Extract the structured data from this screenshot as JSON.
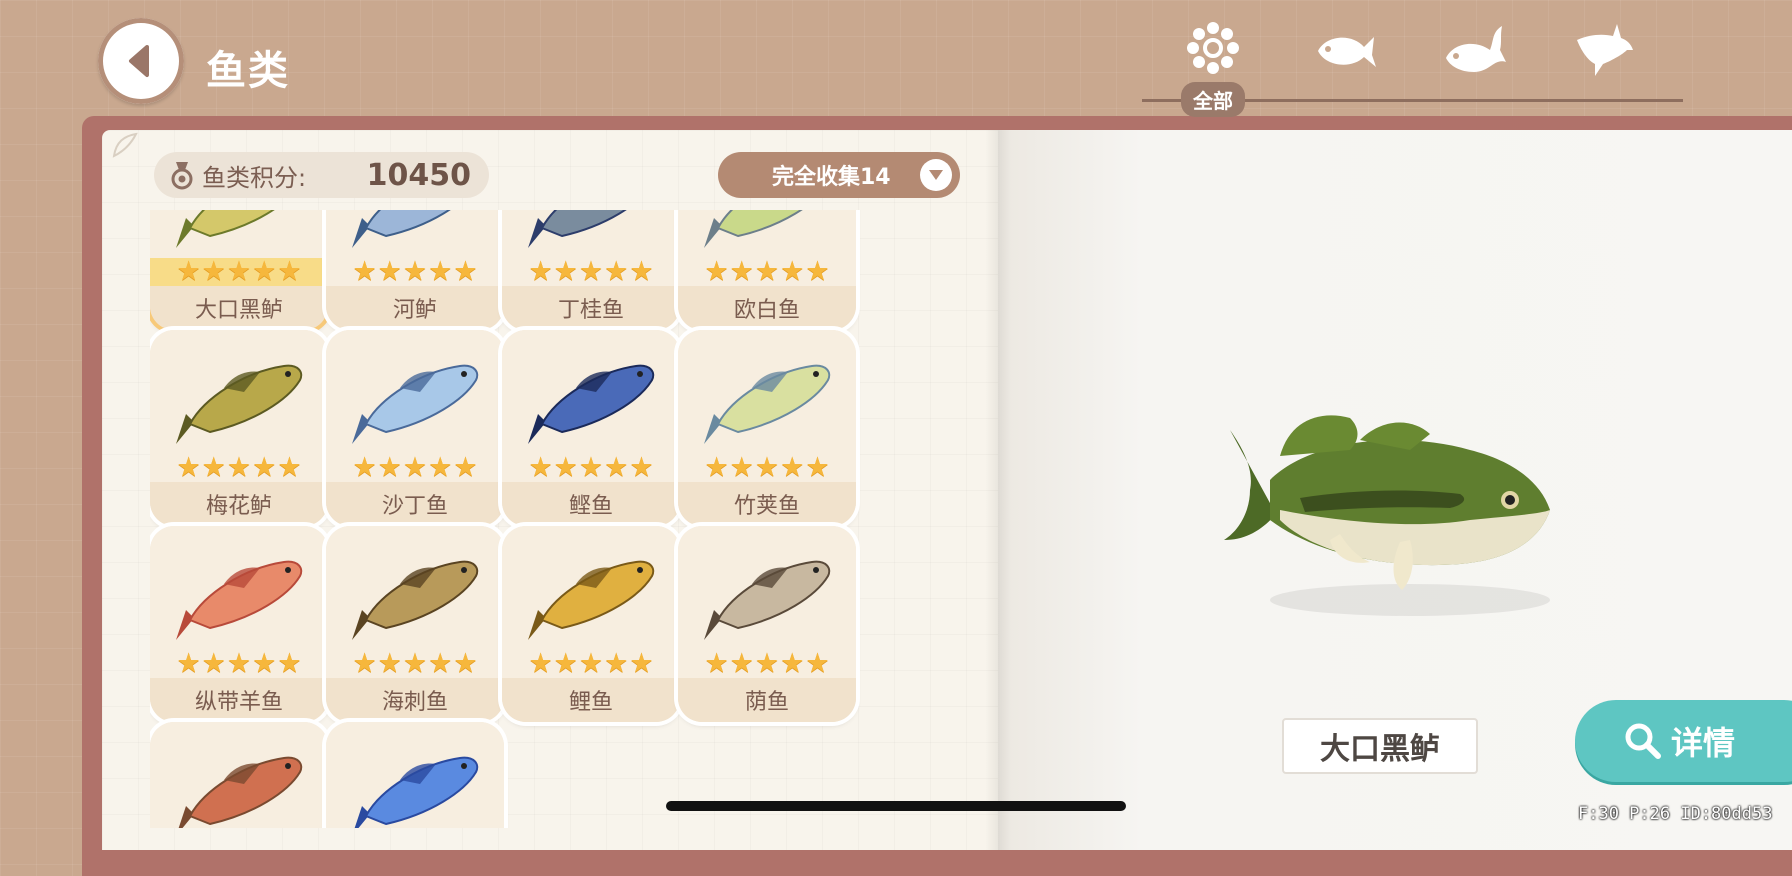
{
  "header": {
    "title": "鱼类",
    "tabs": [
      {
        "label": "全部",
        "icon": "all-dots-icon"
      },
      {
        "label": "",
        "icon": "small-fish-icon"
      },
      {
        "label": "",
        "icon": "medium-fish-icon"
      },
      {
        "label": "",
        "icon": "shark-icon"
      }
    ]
  },
  "score": {
    "label": "鱼类积分:",
    "value": "10450"
  },
  "filter": {
    "label": "完全收集14"
  },
  "fish_cards": [
    {
      "name": "大口黑鲈",
      "stars": 5,
      "selected": true
    },
    {
      "name": "河鲈",
      "stars": 5
    },
    {
      "name": "丁桂鱼",
      "stars": 5
    },
    {
      "name": "欧白鱼",
      "stars": 5
    },
    {
      "name": "梅花鲈",
      "stars": 5
    },
    {
      "name": "沙丁鱼",
      "stars": 5
    },
    {
      "name": "鲣鱼",
      "stars": 5
    },
    {
      "name": "竹荚鱼",
      "stars": 5
    },
    {
      "name": "纵带羊鱼",
      "stars": 5
    },
    {
      "name": "海刺鱼",
      "stars": 5
    },
    {
      "name": "鲤鱼",
      "stars": 5
    },
    {
      "name": "荫鱼",
      "stars": 5
    },
    {
      "name": "",
      "stars": 0
    },
    {
      "name": "",
      "stars": 0
    }
  ],
  "detail": {
    "fish_name": "大口黑鲈",
    "button_label": "详情"
  },
  "debug": "F:30  P:26  ID:80dd53",
  "colors": {
    "accent": "#5ec6c2",
    "star": "#f6b73c",
    "book": "#b0726a"
  }
}
